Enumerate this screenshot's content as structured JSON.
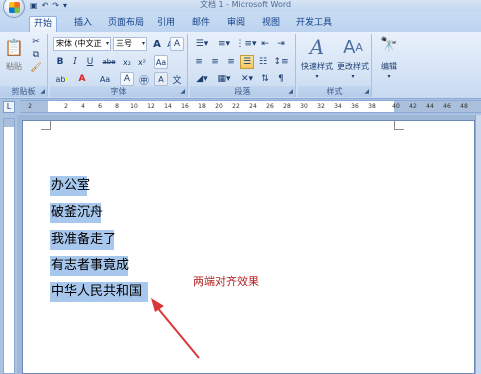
{
  "window": {
    "title": "文档 1 - Microsoft Word"
  },
  "quick_access": {
    "save_icon": "save-icon",
    "undo_icon": "undo-icon",
    "redo_icon": "redo-icon",
    "dropdown_icon": "chevron-down-icon"
  },
  "tabs": [
    {
      "label": "开始",
      "active": true
    },
    {
      "label": "插入",
      "active": false
    },
    {
      "label": "页面布局",
      "active": false
    },
    {
      "label": "引用",
      "active": false
    },
    {
      "label": "邮件",
      "active": false
    },
    {
      "label": "审阅",
      "active": false
    },
    {
      "label": "视图",
      "active": false
    },
    {
      "label": "开发工具",
      "active": false
    }
  ],
  "ribbon": {
    "clipboard": {
      "paste_label": "粘贴",
      "group_label": "剪贴板"
    },
    "font": {
      "font_name": "宋体 (中文正",
      "font_size": "三号",
      "group_label": "字体",
      "bold": "B",
      "italic": "I",
      "underline": "U",
      "strike": "abe",
      "subscript": "x₂",
      "superscript": "x²",
      "grow": "A",
      "shrink": "A",
      "case": "Aa",
      "clear": "A"
    },
    "paragraph": {
      "group_label": "段落"
    },
    "styles": {
      "quick_styles_label": "快速样式",
      "change_styles_label": "更改样式",
      "group_label": "样式"
    },
    "editing": {
      "label": "编辑"
    }
  },
  "ruler": {
    "ticks": [
      "2",
      "2",
      "4",
      "6",
      "8",
      "10",
      "12",
      "14",
      "16",
      "18",
      "20",
      "22",
      "24",
      "26",
      "28",
      "30",
      "32",
      "34",
      "36",
      "38",
      "40",
      "42",
      "44",
      "46",
      "48"
    ]
  },
  "document": {
    "lines": [
      "办公室",
      "破釜沉舟",
      "我准备走了",
      "有志者事竟成",
      "中华人民共和国"
    ],
    "annotation": "两端对齐效果"
  },
  "colors": {
    "selection": "#a7c7ec",
    "annotation_text": "#b22222",
    "arrow": "#d9383a"
  }
}
